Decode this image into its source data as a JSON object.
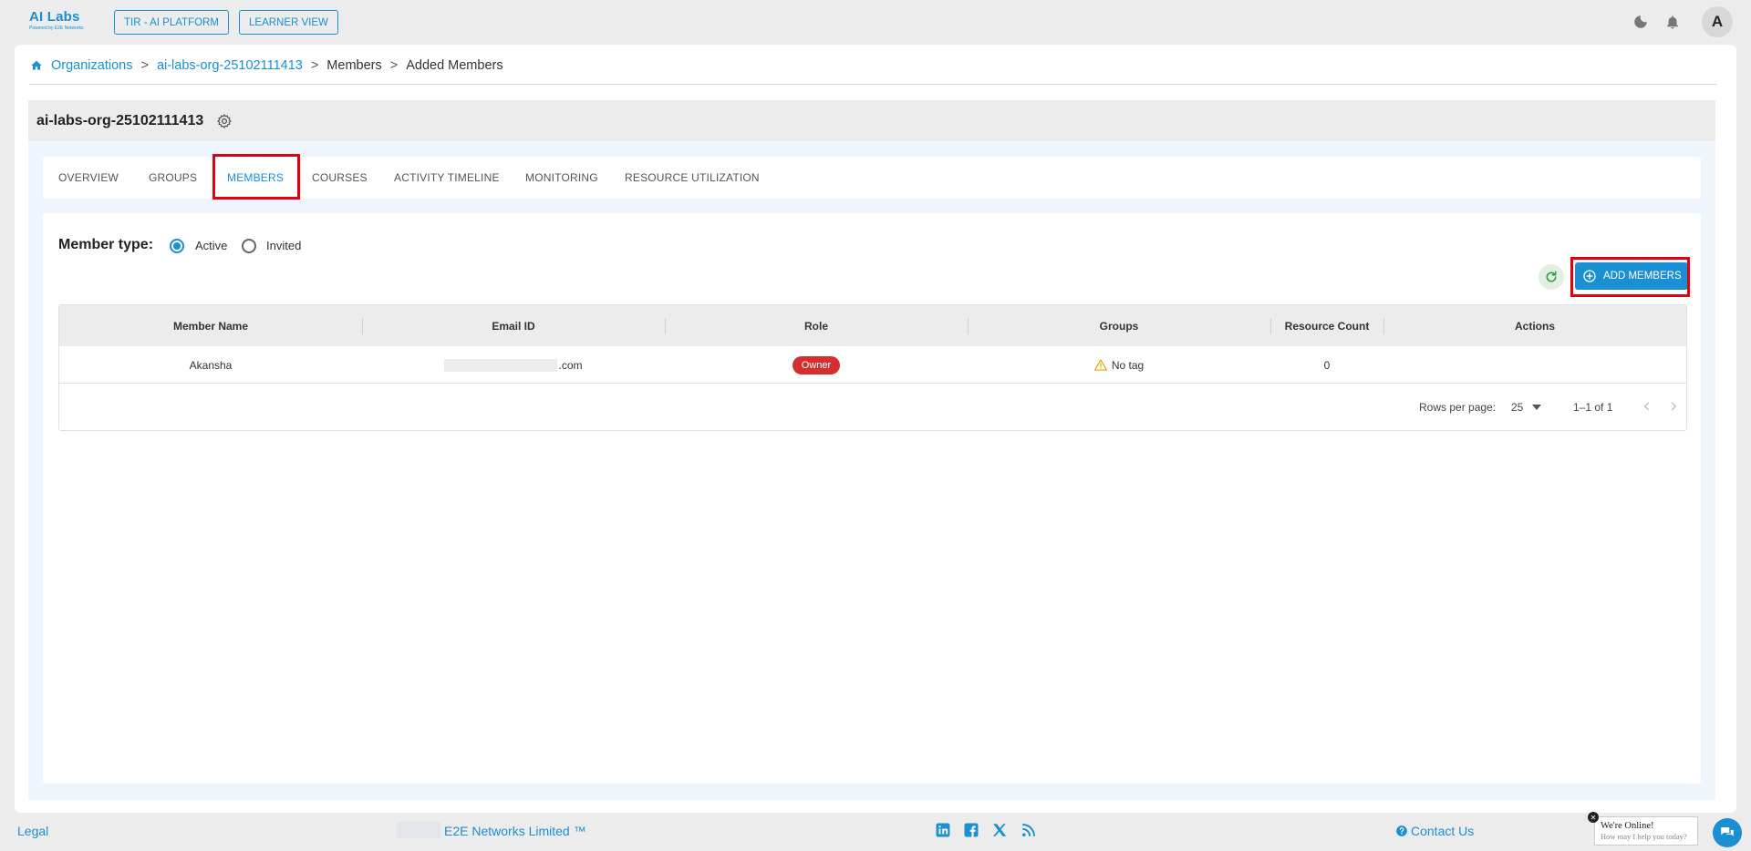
{
  "app": {
    "logo_text": "AI Labs",
    "logo_subtext": "Powered by E2E Networks",
    "accent": "#1a8fd1"
  },
  "topbar": {
    "tir_button": "TIR - AI PLATFORM",
    "learner_button": "LEARNER VIEW",
    "theme_icon": "moon-icon",
    "notification_icon": "bell-icon",
    "avatar_initial": "A"
  },
  "breadcrumb": {
    "items": [
      "Organizations",
      "ai-labs-org-25102111413",
      "Members",
      "Added Members"
    ],
    "separator": ">"
  },
  "org": {
    "title": "ai-labs-org-25102111413",
    "settings_icon": "gear-icon"
  },
  "tabs": [
    {
      "label": "OVERVIEW",
      "active": false
    },
    {
      "label": "GROUPS",
      "active": false
    },
    {
      "label": "MEMBERS",
      "active": true
    },
    {
      "label": "COURSES",
      "active": false
    },
    {
      "label": "ACTIVITY TIMELINE",
      "active": false
    },
    {
      "label": "MONITORING",
      "active": false
    },
    {
      "label": "RESOURCE UTILIZATION",
      "active": false
    }
  ],
  "member_type": {
    "label": "Member type:",
    "options": [
      {
        "label": "Active",
        "checked": true
      },
      {
        "label": "Invited",
        "checked": false
      }
    ]
  },
  "actions": {
    "refresh_icon": "refresh-icon",
    "add_members_label": "ADD MEMBERS",
    "add_icon": "plus-circle-icon"
  },
  "table": {
    "columns": [
      "Member Name",
      "Email ID",
      "Role",
      "Groups",
      "Resource Count",
      "Actions"
    ],
    "rows": [
      {
        "member_name": "Akansha",
        "email_suffix": ".com",
        "role": "Owner",
        "groups": "No tag",
        "resource_count": "0"
      }
    ],
    "footer": {
      "rows_per_page_label": "Rows per page:",
      "rows_per_page_value": "25",
      "range": "1–1 of 1"
    }
  },
  "footer": {
    "legal": "Legal",
    "company": "E2E Networks Limited ™",
    "social_icons": [
      "linkedin-icon",
      "facebook-icon",
      "x-icon",
      "rss-icon"
    ],
    "contact": "Contact Us"
  },
  "chat": {
    "title": "We're Online!",
    "subtitle": "How may I help you today?"
  }
}
